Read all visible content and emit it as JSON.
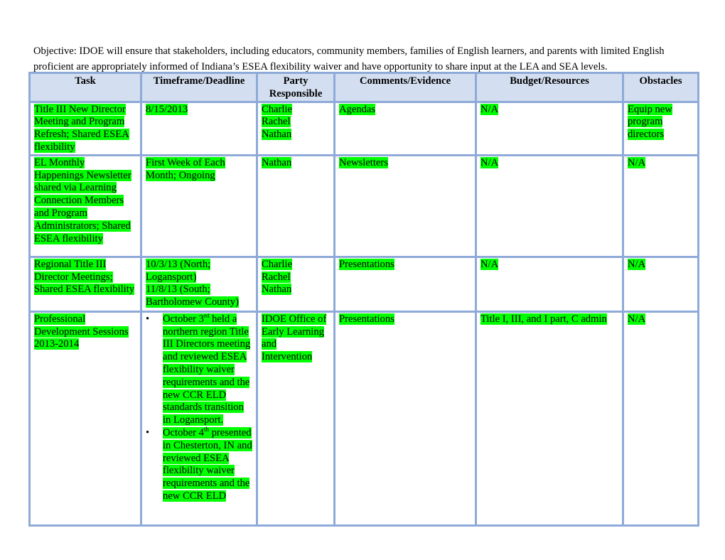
{
  "objective": "Objective:  IDOE will ensure that stakeholders, including educators, community members, families of English learners, and parents with limited English proficient are appropriately informed of Indiana’s ESEA flexibility waiver and have opportunity to share input at the LEA and SEA levels.",
  "table": {
    "headers": [
      "Task",
      "Timeframe/Deadline",
      "Party Responsible",
      "Comments/Evidence",
      "Budget/Resources",
      "Obstacles"
    ],
    "header_bg": "#d3dff0",
    "border_color": "#8eaad8",
    "highlight_color": "#00ff00",
    "rows": [
      {
        "task": "Title III New Director Meeting and Program Refresh; Shared ESEA flexibility",
        "timeframe": "8/15/2013",
        "party": [
          "Charlie",
          "Rachel",
          "Nathan"
        ],
        "comments": "Agendas",
        "budget": "N/A",
        "obstacles": "Equip new program directors"
      },
      {
        "task": "EL Monthly Happenings Newsletter shared via Learning Connection Members and Program Administrators; Shared ESEA flexibility",
        "timeframe": "First Week of Each Month; Ongoing",
        "party": [
          "Nathan"
        ],
        "comments": "Newsletters",
        "budget": "N/A",
        "obstacles": "N/A"
      },
      {
        "task": "Regional Title III Director Meetings; Shared ESEA flexibility",
        "timeframe_lines": [
          "10/3/13 (North; Logansport)",
          "11/8/13 (South; Bartholomew County)"
        ],
        "party": [
          "Charlie",
          "Rachel",
          "Nathan"
        ],
        "comments": "Presentations",
        "budget": "N/A",
        "obstacles": "N/A"
      },
      {
        "task": "Professional Development Sessions 2013-2014",
        "timeframe_bullets": [
          {
            "pre": "October 3",
            "sup": "rd",
            "post": " held a northern region Title III Directors meeting and reviewed ESEA flexibility waiver requirements and the new CCR ELD standards transition in Logansport."
          },
          {
            "pre": "October 4",
            "sup": "th",
            "post": " presented in Chesterton, IN and reviewed ESEA flexibility waiver requirements and the new CCR ELD"
          }
        ],
        "bullet_glyph": "•",
        "party": "IDOE Office of Early Learning and Intervention",
        "comments": "Presentations",
        "budget": "Title I, III, and I part, C admin",
        "obstacles": "N/A"
      }
    ]
  }
}
